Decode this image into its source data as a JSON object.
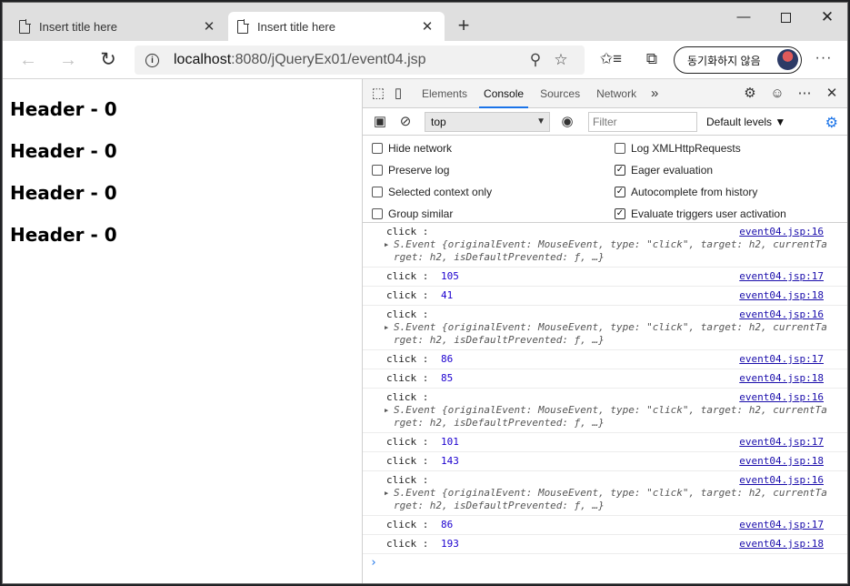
{
  "tabs": [
    {
      "title": "Insert title here",
      "active": false
    },
    {
      "title": "Insert title here",
      "active": true
    }
  ],
  "address": {
    "host": "localhost",
    "rest": ":8080/jQueryEx01/event04.jsp"
  },
  "sync_label": "동기화하지 않음",
  "headers": [
    "Header - 0",
    "Header - 0",
    "Header - 0",
    "Header - 0"
  ],
  "devtools": {
    "tabs": [
      "Elements",
      "Console",
      "Sources",
      "Network"
    ],
    "active_tab": "Console",
    "context": "top",
    "filter_placeholder": "Filter",
    "levels": "Default levels",
    "options_left": [
      {
        "label": "Hide network",
        "checked": false
      },
      {
        "label": "Preserve log",
        "checked": false
      },
      {
        "label": "Selected context only",
        "checked": false
      },
      {
        "label": "Group similar",
        "checked": false
      }
    ],
    "options_right": [
      {
        "label": "Log XMLHttpRequests",
        "checked": false
      },
      {
        "label": "Eager evaluation",
        "checked": true
      },
      {
        "label": "Autocomplete from history",
        "checked": true
      },
      {
        "label": "Evaluate triggers user activation",
        "checked": true
      }
    ]
  },
  "console_logs": [
    {
      "text": "click :",
      "value": "",
      "src": "event04.jsp:16",
      "obj1": "S.Event {originalEvent: MouseEvent, type: \"click\", target: h2, currentTa",
      "obj2": "rget: h2, isDefaultPrevented: ƒ, …}"
    },
    {
      "text": "click : ",
      "value": "105",
      "src": "event04.jsp:17"
    },
    {
      "text": "click : ",
      "value": "41",
      "src": "event04.jsp:18"
    },
    {
      "text": "click :",
      "value": "",
      "src": "event04.jsp:16",
      "obj1": "S.Event {originalEvent: MouseEvent, type: \"click\", target: h2, currentTa",
      "obj2": "rget: h2, isDefaultPrevented: ƒ, …}"
    },
    {
      "text": "click : ",
      "value": "86",
      "src": "event04.jsp:17"
    },
    {
      "text": "click : ",
      "value": "85",
      "src": "event04.jsp:18"
    },
    {
      "text": "click :",
      "value": "",
      "src": "event04.jsp:16",
      "obj1": "S.Event {originalEvent: MouseEvent, type: \"click\", target: h2, currentTa",
      "obj2": "rget: h2, isDefaultPrevented: ƒ, …}"
    },
    {
      "text": "click : ",
      "value": "101",
      "src": "event04.jsp:17"
    },
    {
      "text": "click : ",
      "value": "143",
      "src": "event04.jsp:18"
    },
    {
      "text": "click :",
      "value": "",
      "src": "event04.jsp:16",
      "obj1": "S.Event {originalEvent: MouseEvent, type: \"click\", target: h2, currentTa",
      "obj2": "rget: h2, isDefaultPrevented: ƒ, …}"
    },
    {
      "text": "click : ",
      "value": "86",
      "src": "event04.jsp:17"
    },
    {
      "text": "click : ",
      "value": "193",
      "src": "event04.jsp:18"
    }
  ],
  "prompt": "›"
}
